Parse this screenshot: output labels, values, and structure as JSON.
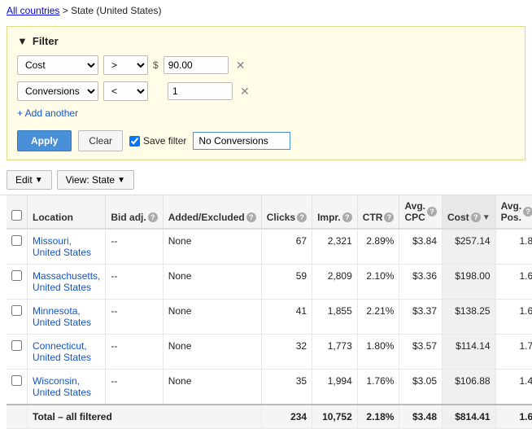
{
  "breadcrumb": {
    "link": "All countries",
    "separator": " > ",
    "current": "State (United States)"
  },
  "filter": {
    "title": "Filter",
    "rows": [
      {
        "field": "Cost",
        "operator": ">",
        "prefix": "$",
        "value": "90.00"
      },
      {
        "field": "Conversions",
        "operator": "<",
        "prefix": "",
        "value": "1"
      }
    ],
    "add_another": "+ Add another",
    "apply_label": "Apply",
    "clear_label": "Clear",
    "save_filter_label": "Save filter",
    "save_filter_value": "No Conversions"
  },
  "toolbar": {
    "edit_label": "Edit",
    "view_label": "View: State"
  },
  "table": {
    "headers": [
      {
        "key": "checkbox",
        "label": ""
      },
      {
        "key": "location",
        "label": "Location"
      },
      {
        "key": "bid_adj",
        "label": "Bid adj.",
        "help": true
      },
      {
        "key": "added_excluded",
        "label": "Added/Excluded",
        "help": true
      },
      {
        "key": "clicks",
        "label": "Clicks",
        "help": true
      },
      {
        "key": "impr",
        "label": "Impr.",
        "help": true
      },
      {
        "key": "ctr",
        "label": "CTR",
        "help": true
      },
      {
        "key": "avg_cpc",
        "label": "Avg. CPC",
        "help": true
      },
      {
        "key": "cost",
        "label": "Cost",
        "help": true,
        "sorted": true,
        "sort_dir": "desc"
      },
      {
        "key": "avg_pos",
        "label": "Avg. Pos.",
        "help": true
      }
    ],
    "rows": [
      {
        "location": "Missouri, United States",
        "bid_adj": "--",
        "added_excluded": "None",
        "clicks": "67",
        "impr": "2,321",
        "ctr": "2.89%",
        "avg_cpc": "$3.84",
        "cost": "$257.14",
        "avg_pos": "1.8"
      },
      {
        "location": "Massachusetts, United States",
        "bid_adj": "--",
        "added_excluded": "None",
        "clicks": "59",
        "impr": "2,809",
        "ctr": "2.10%",
        "avg_cpc": "$3.36",
        "cost": "$198.00",
        "avg_pos": "1.6"
      },
      {
        "location": "Minnesota, United States",
        "bid_adj": "--",
        "added_excluded": "None",
        "clicks": "41",
        "impr": "1,855",
        "ctr": "2.21%",
        "avg_cpc": "$3.37",
        "cost": "$138.25",
        "avg_pos": "1.6"
      },
      {
        "location": "Connecticut, United States",
        "bid_adj": "--",
        "added_excluded": "None",
        "clicks": "32",
        "impr": "1,773",
        "ctr": "1.80%",
        "avg_cpc": "$3.57",
        "cost": "$114.14",
        "avg_pos": "1.7"
      },
      {
        "location": "Wisconsin, United States",
        "bid_adj": "--",
        "added_excluded": "None",
        "clicks": "35",
        "impr": "1,994",
        "ctr": "1.76%",
        "avg_cpc": "$3.05",
        "cost": "$106.88",
        "avg_pos": "1.4"
      }
    ],
    "total_row": {
      "label": "Total – all filtered",
      "clicks": "234",
      "impr": "10,752",
      "ctr": "2.18%",
      "avg_cpc": "$3.48",
      "cost": "$814.41",
      "avg_pos": "1.6"
    }
  }
}
